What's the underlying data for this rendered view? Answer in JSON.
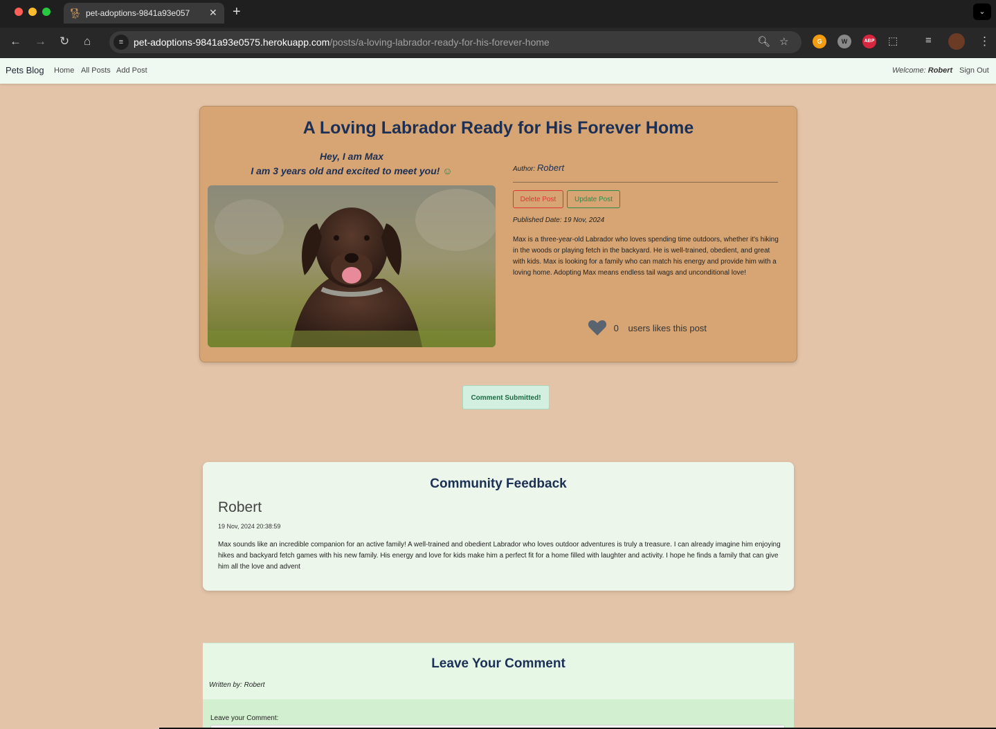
{
  "browser": {
    "tab_title": "pet-adoptions-9841a93e057",
    "url_host": "pet-adoptions-9841a93e0575.herokuapp.com",
    "url_path": "/posts/a-loving-labrador-ready-for-his-forever-home",
    "ext_abp": "ABP"
  },
  "nav": {
    "brand": "Pets Blog",
    "links": [
      "Home",
      "All Posts",
      "Add Post"
    ],
    "welcome_label": "Welcome: ",
    "welcome_user": "Robert",
    "sign_out": "Sign Out"
  },
  "post": {
    "title": "A Loving Labrador Ready for His Forever Home",
    "intro_line1": "Hey, I am Max",
    "intro_line2": "I am 3 years old and excited to meet you!",
    "author_label": "Author: ",
    "author_name": "Robert",
    "delete_label": "Delete Post",
    "update_label": "Update Post",
    "published": "Published Date: 19 Nov, 2024",
    "body": "Max is a three-year-old Labrador who loves spending time outdoors, whether it's hiking in the woods or playing fetch in the backyard. He is well-trained, obedient, and great with kids. Max is looking for a family who can match his energy and provide him with a loving home. Adopting Max means endless tail wags and unconditional love!",
    "likes_count": "0",
    "likes_text": "users likes this post"
  },
  "alert": {
    "message": "Comment Submitted!"
  },
  "feedback": {
    "title": "Community Feedback",
    "comments": [
      {
        "author": "Robert",
        "date": "19 Nov, 2024 20:38:59",
        "body": "Max sounds like an incredible companion for an active family! A well-trained and obedient Labrador who loves outdoor adventures is truly a treasure. I can already imagine him enjoying hikes and backyard fetch games with his new family. His energy and love for kids make him a perfect fit for a home filled with laughter and activity. I hope he finds a family that can give him all the love and advent"
      }
    ]
  },
  "leave_comment": {
    "title": "Leave Your Comment",
    "written_by": "Written by: Robert",
    "label": "Leave your Comment:"
  },
  "colors": {
    "page_bg": "#e3c4a8",
    "card_bg": "#d7a574",
    "title": "#1c2f54",
    "delete": "#dd3333",
    "update": "#2b8a4a"
  }
}
